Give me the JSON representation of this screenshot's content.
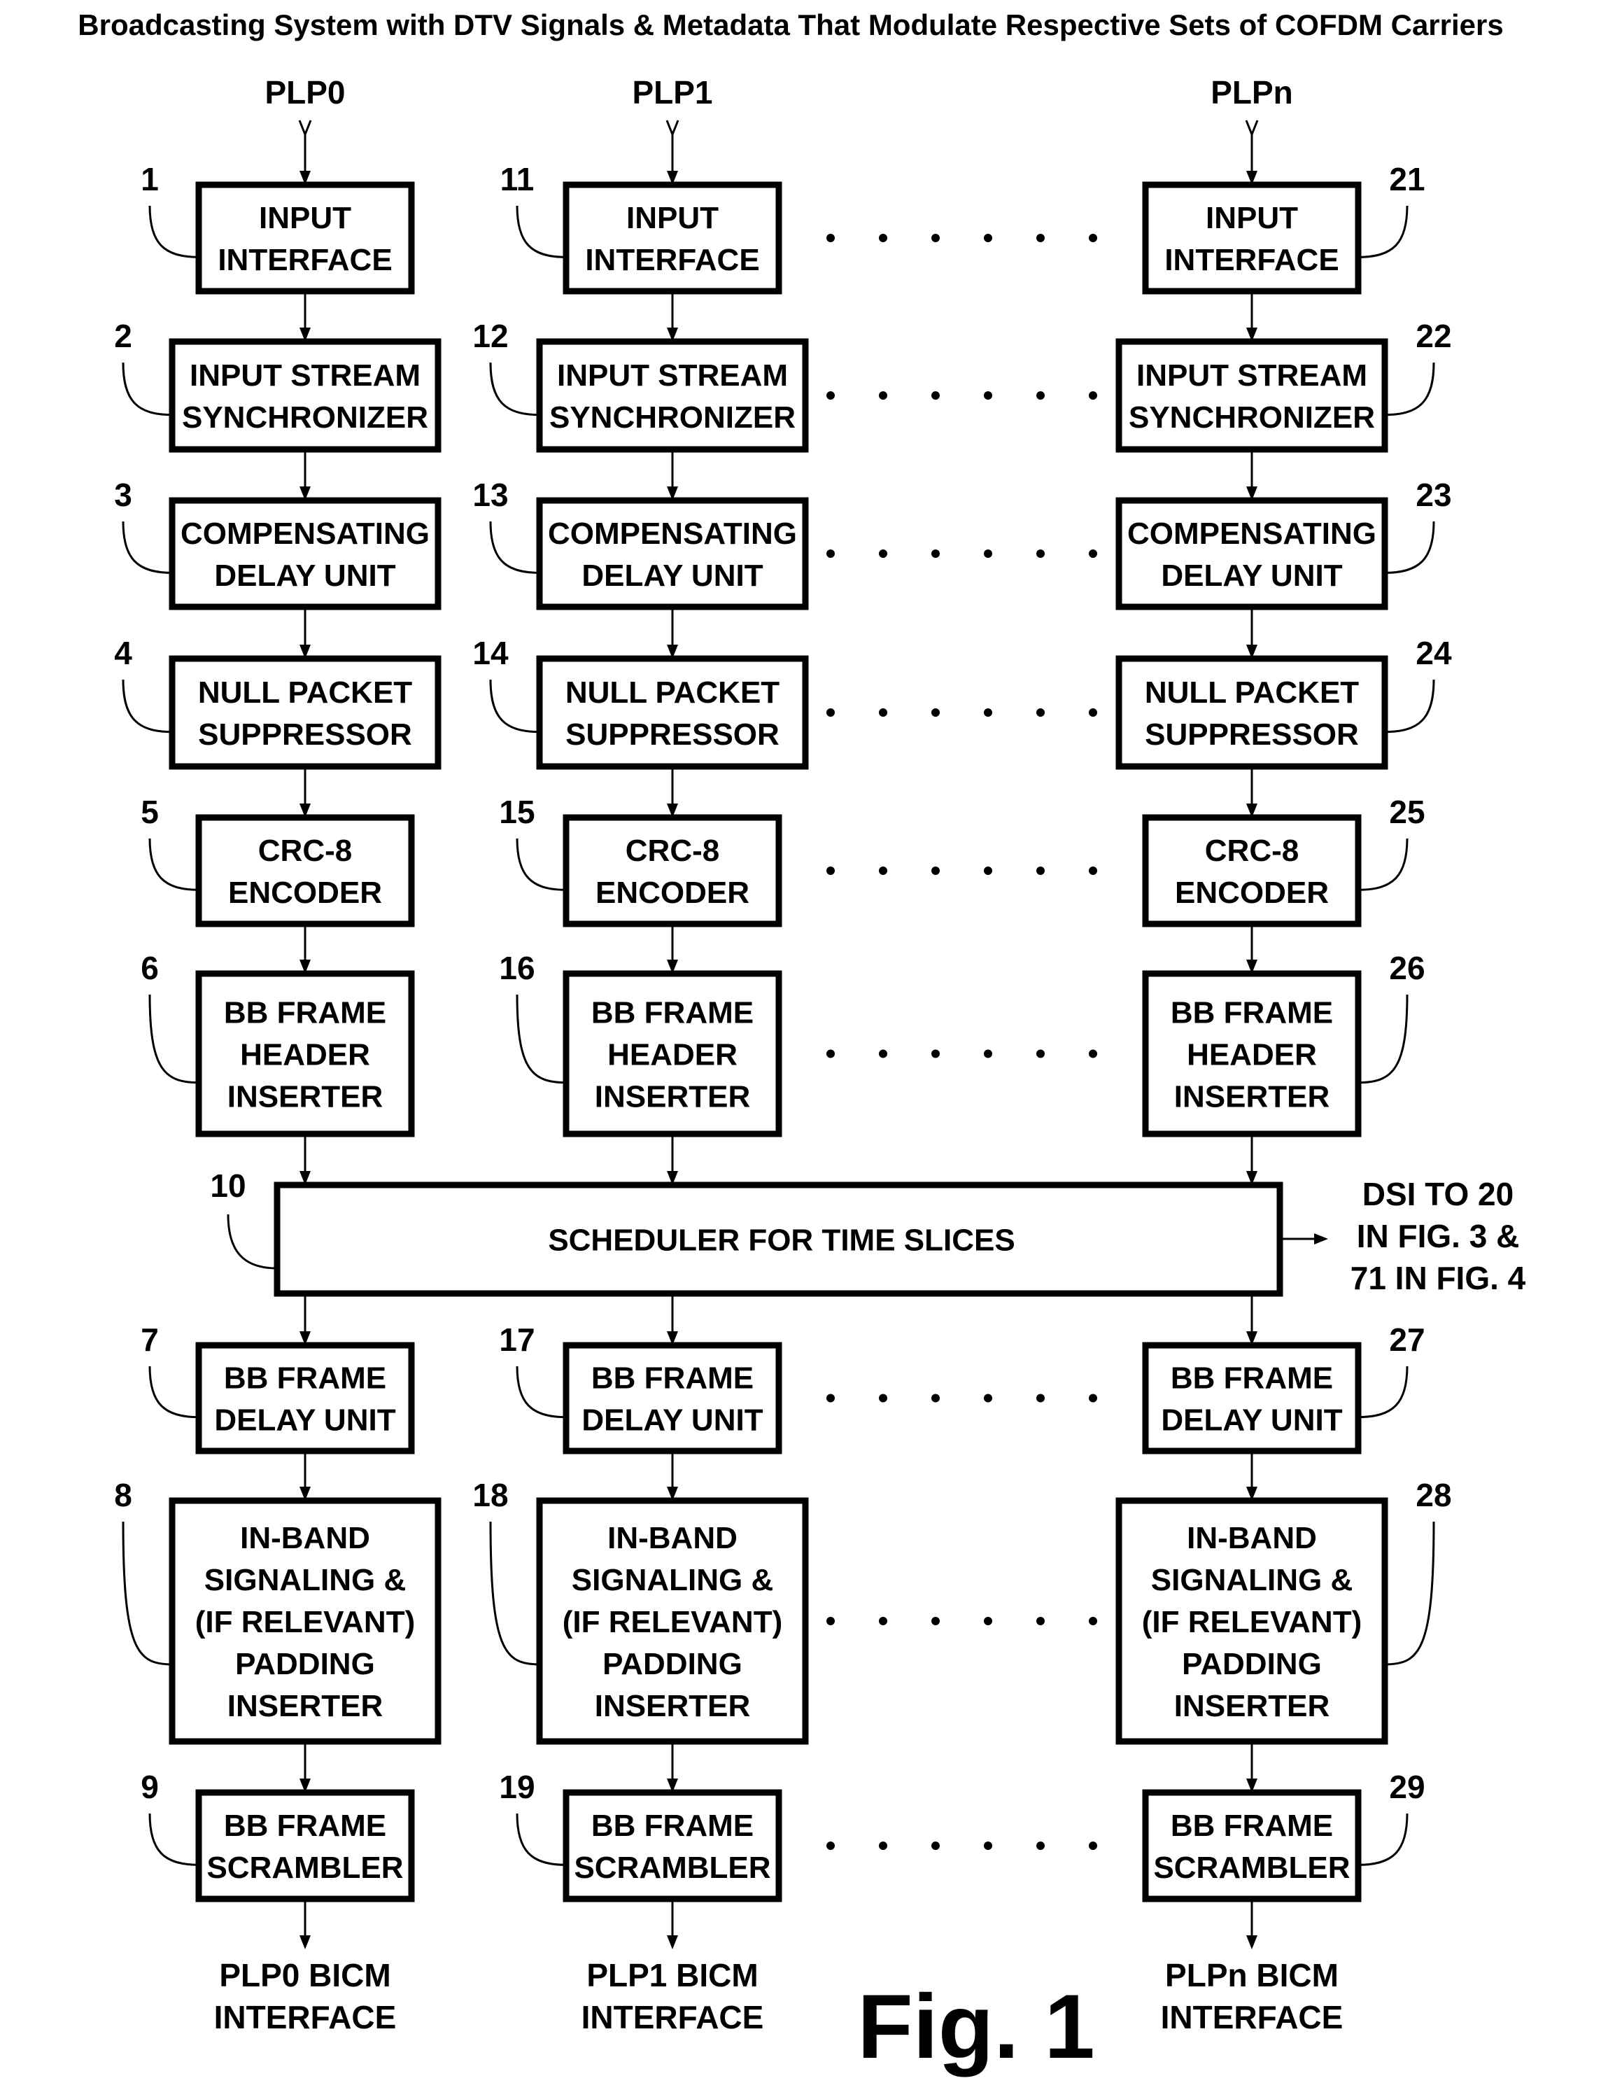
{
  "title": "Broadcasting System with DTV Signals & Metadata That Modulate Respective Sets of COFDM Carriers",
  "figure_label": "Fig. 1",
  "inputs": [
    "PLP0",
    "PLP1",
    "PLPn"
  ],
  "outputs": [
    [
      "PLP0 BICM",
      "INTERFACE"
    ],
    [
      "PLP1 BICM",
      "INTERFACE"
    ],
    [
      "PLPn BICM",
      "INTERFACE"
    ]
  ],
  "upper_stages": [
    {
      "lines": [
        "INPUT",
        "INTERFACE"
      ],
      "refs": [
        "1",
        "11",
        "21"
      ]
    },
    {
      "lines": [
        "INPUT STREAM",
        "SYNCHRONIZER"
      ],
      "refs": [
        "2",
        "12",
        "22"
      ]
    },
    {
      "lines": [
        "COMPENSATING",
        "DELAY UNIT"
      ],
      "refs": [
        "3",
        "13",
        "23"
      ]
    },
    {
      "lines": [
        "NULL PACKET",
        "SUPPRESSOR"
      ],
      "refs": [
        "4",
        "14",
        "24"
      ]
    },
    {
      "lines": [
        "CRC-8",
        "ENCODER"
      ],
      "refs": [
        "5",
        "15",
        "25"
      ]
    },
    {
      "lines": [
        "BB FRAME",
        "HEADER",
        "INSERTER"
      ],
      "refs": [
        "6",
        "16",
        "26"
      ]
    }
  ],
  "scheduler": {
    "label": "SCHEDULER FOR TIME SLICES",
    "ref": "10",
    "output_note": [
      "DSI TO 20",
      "IN FIG. 3 &",
      "71 IN FIG. 4"
    ]
  },
  "lower_stages": [
    {
      "lines": [
        "BB FRAME",
        "DELAY UNIT"
      ],
      "refs": [
        "7",
        "17",
        "27"
      ]
    },
    {
      "lines": [
        "IN-BAND",
        "SIGNALING &",
        "(IF RELEVANT)",
        "PADDING",
        "INSERTER"
      ],
      "refs": [
        "8",
        "18",
        "28"
      ]
    },
    {
      "lines": [
        "BB FRAME",
        "SCRAMBLER"
      ],
      "refs": [
        "9",
        "19",
        "29"
      ]
    }
  ]
}
